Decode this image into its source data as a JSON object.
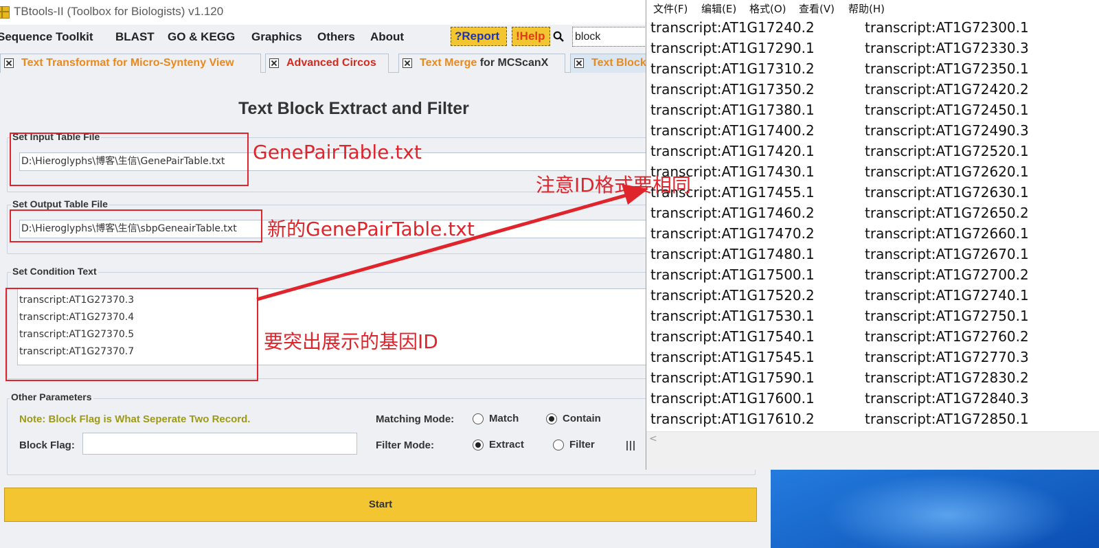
{
  "window": {
    "title": "TBtools-II (Toolbox for Biologists) v1.120"
  },
  "menu": {
    "items": [
      "Sequence Toolkit",
      "BLAST",
      "GO & KEGG",
      "Graphics",
      "Others",
      "About"
    ],
    "report_label": "?Report",
    "help_label": "!Help",
    "search_value": "block"
  },
  "tabs": [
    {
      "part1": "Text Transformat for Micro-Synteny View",
      "part2": "",
      "color": "#e9891e"
    },
    {
      "part1": "Advanced Circos",
      "part2": "",
      "color": "#d42a1f"
    },
    {
      "part1": "Text Merge",
      "part2": " for MCScanX",
      "color": "#e9891e"
    },
    {
      "part1": "Text Block",
      "part2": "",
      "color": "#e9891e"
    }
  ],
  "page": {
    "title": "Text Block Extract and Filter",
    "input_legend": "Set Input Table File",
    "input_value": "D:\\Hieroglyphs\\博客\\生信\\GenePairTable.txt",
    "output_legend": "Set Output Table File",
    "output_value": "D:\\Hieroglyphs\\博客\\生信\\sbpGeneairTable.txt",
    "condition_legend": "Set Condition Text",
    "condition_lines": [
      "transcript:AT1G27370.3",
      "transcript:AT1G27370.4",
      "transcript:AT1G27370.5",
      "transcript:AT1G27370.7"
    ],
    "other_legend": "Other Parameters",
    "note": "Note: Block Flag is What Seperate Two Record.",
    "block_flag_label": "Block Flag:",
    "block_flag_value": "",
    "matching_mode_label": "Matching Mode:",
    "match_label": "Match",
    "contain_label": "Contain",
    "matching_mode_selected": "Contain",
    "filter_mode_label": "Filter Mode:",
    "extract_label": "Extract",
    "filter_label": "Filter",
    "filter_mode_selected": "Extract",
    "start_label": "Start",
    "colors": {
      "accent_yellow": "#f3c531",
      "note_olive": "#9c9a16",
      "annotation_red": "#e0242c"
    }
  },
  "annotations": {
    "input": "GenePairTable.txt",
    "output": "新的GenePairTable.txt",
    "condition": "要突出展示的基因ID",
    "id_format": "注意ID格式要相同"
  },
  "notepad": {
    "menu": [
      "文件(F)",
      "编辑(E)",
      "格式(O)",
      "查看(V)",
      "帮助(H)"
    ],
    "rows": [
      [
        "transcript:AT1G17240.2",
        "transcript:AT1G72300.1"
      ],
      [
        "transcript:AT1G17290.1",
        "transcript:AT1G72330.3"
      ],
      [
        "transcript:AT1G17310.2",
        "transcript:AT1G72350.1"
      ],
      [
        "transcript:AT1G17350.2",
        "transcript:AT1G72420.2"
      ],
      [
        "transcript:AT1G17380.1",
        "transcript:AT1G72450.1"
      ],
      [
        "transcript:AT1G17400.2",
        "transcript:AT1G72490.3"
      ],
      [
        "transcript:AT1G17420.1",
        "transcript:AT1G72520.1"
      ],
      [
        "transcript:AT1G17430.1",
        "transcript:AT1G72620.1"
      ],
      [
        "transcript:AT1G17455.1",
        "transcript:AT1G72630.1"
      ],
      [
        "transcript:AT1G17460.2",
        "transcript:AT1G72650.2"
      ],
      [
        "transcript:AT1G17470.2",
        "transcript:AT1G72660.1"
      ],
      [
        "transcript:AT1G17480.1",
        "transcript:AT1G72670.1"
      ],
      [
        "transcript:AT1G17500.1",
        "transcript:AT1G72700.2"
      ],
      [
        "transcript:AT1G17520.2",
        "transcript:AT1G72740.1"
      ],
      [
        "transcript:AT1G17530.1",
        "transcript:AT1G72750.1"
      ],
      [
        "transcript:AT1G17540.1",
        "transcript:AT1G72760.2"
      ],
      [
        "transcript:AT1G17545.1",
        "transcript:AT1G72770.3"
      ],
      [
        "transcript:AT1G17590.1",
        "transcript:AT1G72830.2"
      ],
      [
        "transcript:AT1G17600.1",
        "transcript:AT1G72840.3"
      ],
      [
        "transcript:AT1G17610.2",
        "transcript:AT1G72850.1"
      ]
    ],
    "scroll_left_glyph": "<"
  }
}
